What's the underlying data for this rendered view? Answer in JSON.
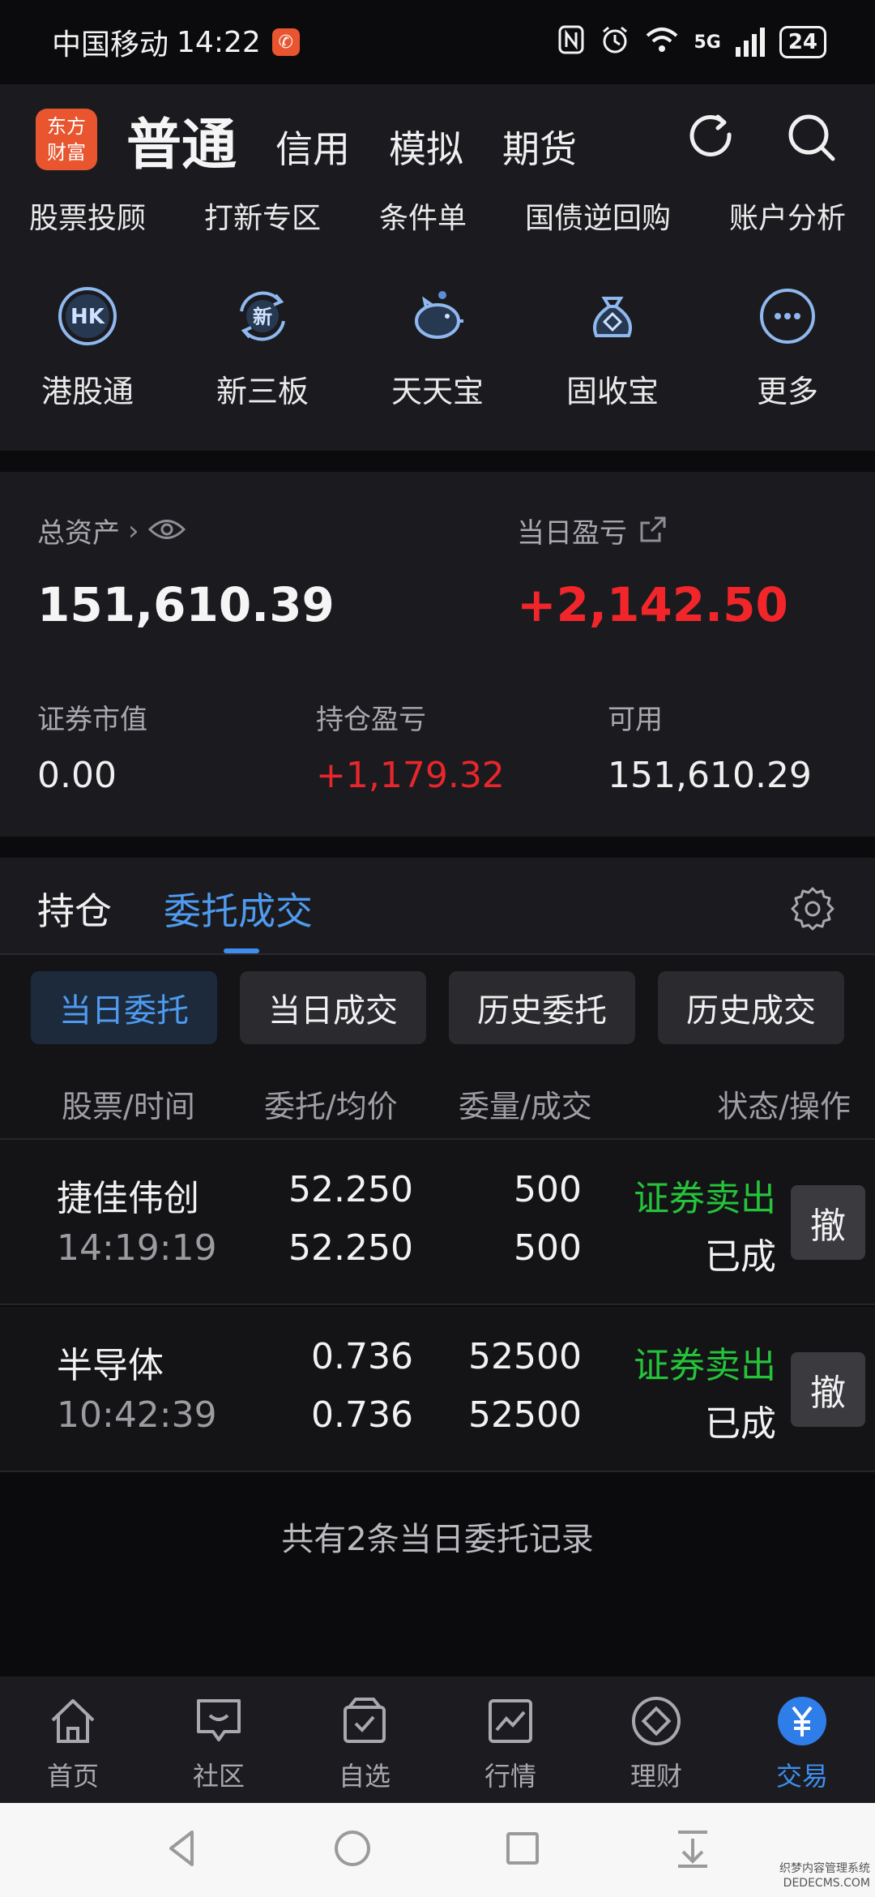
{
  "status_bar": {
    "carrier": "中国移动",
    "time": "14:22",
    "network": "5G",
    "battery": "24"
  },
  "top_nav": {
    "logo_line1": "东方",
    "logo_line2": "财富",
    "main_tab": "普通",
    "tabs": [
      "信用",
      "模拟",
      "期货"
    ]
  },
  "quick_links": {
    "row1": [
      "股票投顾",
      "打新专区",
      "条件单",
      "国债逆回购",
      "账户分析"
    ],
    "row2": [
      {
        "label": "港股通",
        "icon": "hk-icon",
        "glyph": "HK"
      },
      {
        "label": "新三板",
        "icon": "new-three-board-icon",
        "glyph": "新"
      },
      {
        "label": "天天宝",
        "icon": "piggy-bank-icon"
      },
      {
        "label": "固收宝",
        "icon": "money-bag-icon"
      },
      {
        "label": "更多",
        "icon": "more-icon"
      }
    ]
  },
  "assets": {
    "total_label": "总资产",
    "total_value": "151,610.39",
    "daily_pl_label": "当日盈亏",
    "daily_pl_value": "+2,142.50",
    "market_value_label": "证券市值",
    "market_value": "0.00",
    "position_pl_label": "持仓盈亏",
    "position_pl": "+1,179.32",
    "available_label": "可用",
    "available": "151,610.29"
  },
  "tabs": {
    "holdings": "持仓",
    "orders": "委托成交"
  },
  "sub_tabs": [
    "当日委托",
    "当日成交",
    "历史委托",
    "历史成交"
  ],
  "table": {
    "headers": [
      "股票/时间",
      "委托/均价",
      "委量/成交",
      "状态/操作"
    ],
    "rows": [
      {
        "name": "捷佳伟创",
        "time": "14:19:19",
        "order_price": "52.250",
        "avg_price": "52.250",
        "order_qty": "500",
        "filled_qty": "500",
        "type": "证券卖出",
        "state": "已成",
        "action": "撤"
      },
      {
        "name": "半导体",
        "time": "10:42:39",
        "order_price": "0.736",
        "avg_price": "0.736",
        "order_qty": "52500",
        "filled_qty": "52500",
        "type": "证券卖出",
        "state": "已成",
        "action": "撤"
      }
    ],
    "footer": "共有2条当日委托记录"
  },
  "bottom_nav": [
    {
      "label": "首页",
      "icon": "home-icon"
    },
    {
      "label": "社区",
      "icon": "community-icon"
    },
    {
      "label": "自选",
      "icon": "watchlist-icon"
    },
    {
      "label": "行情",
      "icon": "market-icon"
    },
    {
      "label": "理财",
      "icon": "wealth-icon"
    },
    {
      "label": "交易",
      "icon": "trade-icon",
      "active": true
    }
  ],
  "watermark": {
    "line1": "织梦内容管理系统",
    "line2": "DEDECMS.COM"
  },
  "colors": {
    "accent_blue": "#3d8ef0",
    "profit_red": "#f2262a",
    "sell_green": "#25c33a",
    "brand_orange": "#e8552f"
  }
}
